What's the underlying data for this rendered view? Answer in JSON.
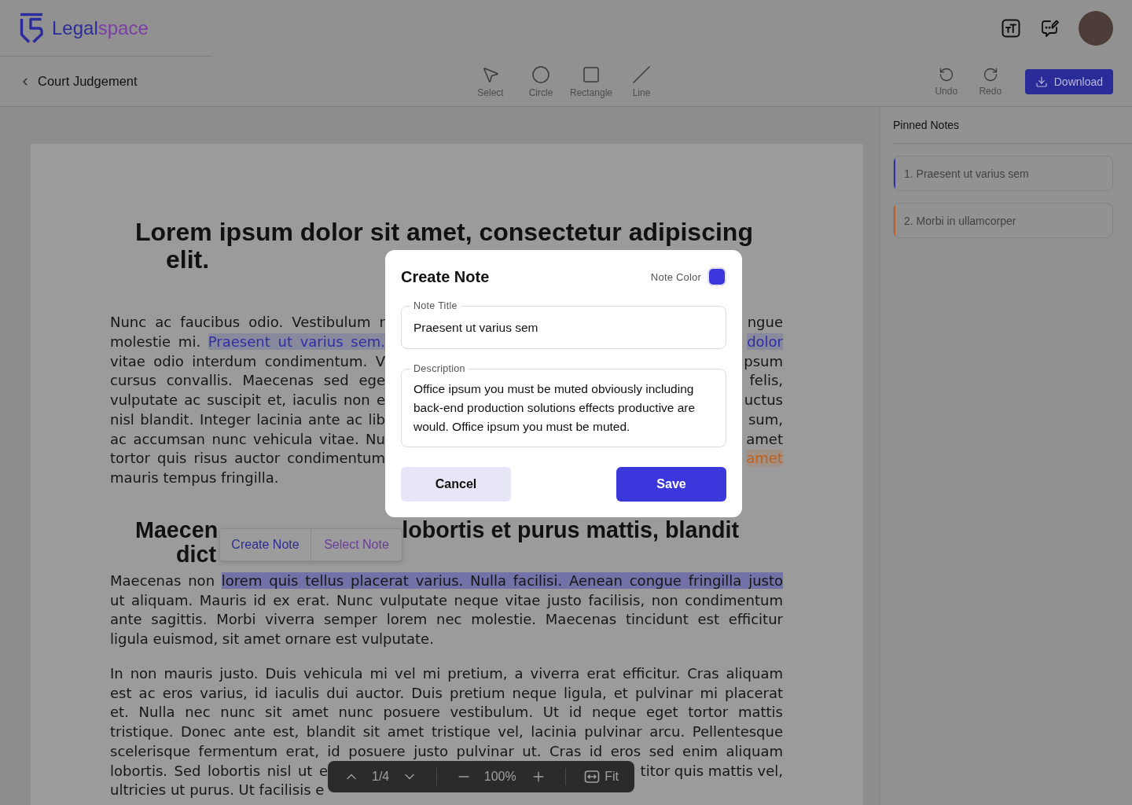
{
  "header": {
    "brand": {
      "first": "Legal",
      "second": "space"
    }
  },
  "toolbar": {
    "back_label": "Court Judgement",
    "tools": [
      {
        "label": "Select",
        "kind": "select"
      },
      {
        "label": "Circle",
        "kind": "circle"
      },
      {
        "label": "Rectangle",
        "kind": "rectangle"
      },
      {
        "label": "Line",
        "kind": "line"
      }
    ],
    "history": [
      {
        "label": "Undo",
        "kind": "undo"
      },
      {
        "label": "Redo",
        "kind": "redo"
      }
    ],
    "download": "Download"
  },
  "document": {
    "blocks": [
      {
        "kind": "heading",
        "text": "Lorem ipsum dolor sit amet, consectetur adipiscing elit."
      },
      {
        "kind": "covered_paragraph",
        "lines": [
          {
            "left": "Nunc ac faucibus odio. Vestibulum r",
            "right": "ngue"
          },
          {
            "left": [
              {
                "text": "molestie mi. ",
                "kind": "plain"
              },
              {
                "text": "Praesent ut varius sem.",
                "kind": "note",
                "color": "#2e2ea6"
              }
            ],
            "right": [
              {
                "text": "dolor",
                "kind": "note",
                "color": "#2e2ea6"
              }
            ]
          },
          {
            "left": "vitae odio interdum condimentum. V",
            "right": "psum"
          },
          {
            "left": "cursus convallis. Maecenas sed ege",
            "right": "felis,"
          },
          {
            "left": "vulputate ac suscipit et, iaculis non e",
            "right": "uctus"
          },
          {
            "left": "nisl blandit. Integer lacinia ante ac lib",
            "right": "sum,"
          },
          {
            "left": "ac accumsan nunc vehicula vitae. Nu",
            "right": "amet"
          },
          {
            "left": "tortor quis risus auctor condimentum",
            "right": [
              {
                "text": "amet",
                "kind": "note",
                "color": "#c0601c"
              }
            ]
          },
          {
            "left": "mauris tempus fringilla."
          }
        ]
      },
      {
        "kind": "covered_heading",
        "lines": [
          {
            "left": "Maecen",
            "right": "lobortis et purus mattis, blandit"
          },
          {
            "left": "dict"
          }
        ]
      },
      {
        "kind": "paragraph",
        "lines": [
          {
            "left": [
              {
                "text": "Maecenas non ",
                "kind": "plain"
              },
              {
                "text": "lorem quis tellus placerat varius. Nulla facilisi. Aenean congue fringilla justo",
                "kind": "selection"
              }
            ]
          },
          {
            "left": "ut aliquam. Mauris id ex erat. Nunc vulputate neque vitae justo facilisis, non condimentum"
          },
          {
            "left": "ante sagittis. Morbi viverra semper lorem nec molestie. Maecenas tincidunt est efficitur"
          },
          {
            "left": "ligula euismod, sit amet ornare est vulputate."
          }
        ]
      },
      {
        "kind": "covered_paragraph",
        "lines": [
          {
            "left": "In non mauris justo. Duis vehicula mi vel mi pretium, a viverra erat efficitur. Cras aliquam"
          },
          {
            "left": "est ac eros varius, id iaculis dui auctor. Duis pretium neque ligula, et pulvinar mi placerat"
          },
          {
            "left": "et. Nulla nec nunc sit amet nunc posuere vestibulum. Ut id neque eget tortor mattis"
          },
          {
            "left": "tristique. Donec ante est, blandit sit amet tristique vel, lacinia pulvinar arcu. Pellentesque"
          },
          {
            "left": "scelerisque fermentum erat, id posuere justo pulvinar ut. Cras id eros sed enim aliquam"
          },
          {
            "left": "lobortis. Sed lobortis nisl ut e",
            "right": "titor quis mattis vel,"
          },
          {
            "left": "ultricies ut purus. Ut facilisis e"
          }
        ]
      }
    ]
  },
  "selection_popup": {
    "actions": [
      {
        "label": "Create Note",
        "kind": "create"
      },
      {
        "label": "Select Note",
        "kind": "select"
      }
    ]
  },
  "modal": {
    "title": "Create Note",
    "color_picker": {
      "label": "Note Color",
      "color": "#3b37dc"
    },
    "fields": [
      {
        "label": "Note Title",
        "value": "Praesent ut varius sem",
        "kind": "input"
      },
      {
        "label": "Description",
        "value": "Office ipsum you must be muted obviously including back-end production solutions effects productive are would. Office ipsum you must be muted.",
        "kind": "textarea"
      }
    ],
    "buttons": [
      {
        "label": "Cancel",
        "kind": "secondary"
      },
      {
        "label": "Save",
        "kind": "primary"
      }
    ]
  },
  "page_controls": {
    "page": "1/4",
    "zoom": "100%",
    "fit": "Fit"
  },
  "pinned_notes": {
    "title": "Pinned Notes",
    "items": [
      {
        "label": "1. Praesent ut varius sem",
        "color": "#2e2ea6"
      },
      {
        "label": "2. Morbi in ullamcorper",
        "color": "#c0601c"
      }
    ]
  }
}
